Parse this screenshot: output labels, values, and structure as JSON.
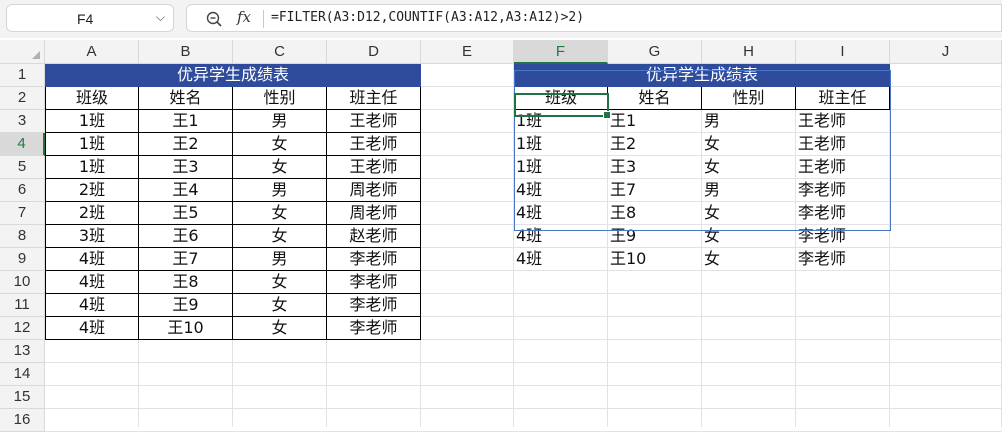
{
  "formula_bar": {
    "name_box": "F4",
    "fx_label": "fx",
    "formula": "=FILTER(A3:D12,COUNTIF(A3:A12,A3:A12)>2)"
  },
  "columns": [
    "A",
    "B",
    "C",
    "D",
    "E",
    "F",
    "G",
    "H",
    "I",
    "J"
  ],
  "rows": [
    "1",
    "2",
    "3",
    "4",
    "5",
    "6",
    "7",
    "8",
    "9",
    "10",
    "11",
    "12",
    "13",
    "14",
    "15",
    "16"
  ],
  "selected": {
    "column": "F",
    "row": "4"
  },
  "source_table": {
    "title": "优异学生成绩表",
    "headers": [
      "班级",
      "姓名",
      "性别",
      "班主任"
    ],
    "rows": [
      [
        "1班",
        "王1",
        "男",
        "王老师"
      ],
      [
        "1班",
        "王2",
        "女",
        "王老师"
      ],
      [
        "1班",
        "王3",
        "女",
        "王老师"
      ],
      [
        "2班",
        "王4",
        "男",
        "周老师"
      ],
      [
        "2班",
        "王5",
        "女",
        "周老师"
      ],
      [
        "3班",
        "王6",
        "女",
        "赵老师"
      ],
      [
        "4班",
        "王7",
        "男",
        "李老师"
      ],
      [
        "4班",
        "王8",
        "女",
        "李老师"
      ],
      [
        "4班",
        "王9",
        "女",
        "李老师"
      ],
      [
        "4班",
        "王10",
        "女",
        "李老师"
      ]
    ]
  },
  "result_table": {
    "title": "优异学生成绩表",
    "headers": [
      "班级",
      "姓名",
      "性别",
      "班主任"
    ],
    "rows": [
      [
        "1班",
        "王1",
        "男",
        "王老师"
      ],
      [
        "1班",
        "王2",
        "女",
        "王老师"
      ],
      [
        "1班",
        "王3",
        "女",
        "王老师"
      ],
      [
        "4班",
        "王7",
        "男",
        "李老师"
      ],
      [
        "4班",
        "王8",
        "女",
        "李老师"
      ],
      [
        "4班",
        "王9",
        "女",
        "李老师"
      ],
      [
        "4班",
        "王10",
        "女",
        "李老师"
      ]
    ]
  },
  "colors": {
    "title_fill": "#2f4b9c",
    "selection": "#217346",
    "spill_border": "#4a76c8"
  }
}
